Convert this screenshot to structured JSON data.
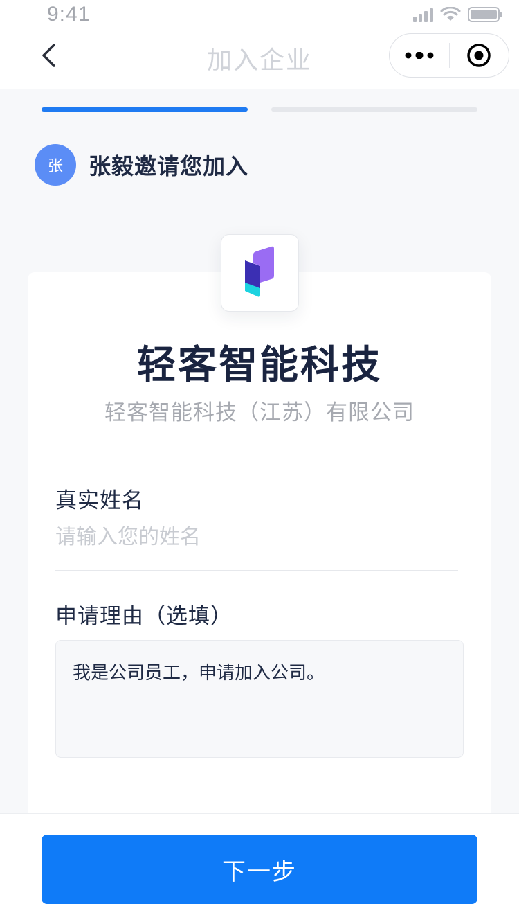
{
  "status_bar": {
    "time": "9:41"
  },
  "nav": {
    "title": "加入企业",
    "back_icon": "chevron-left-icon",
    "more_icon": "more-dots-icon",
    "close_icon": "record-target-icon"
  },
  "progress": {
    "current_step": 1,
    "total_steps": 2
  },
  "inviter": {
    "avatar_text": "张",
    "message": "张毅邀请您加入"
  },
  "company": {
    "short_name": "轻客智能科技",
    "full_name": "轻客智能科技（江苏）有限公司",
    "logo_icon": "company-logo-icon"
  },
  "form": {
    "name_label": "真实姓名",
    "name_placeholder": "请输入您的姓名",
    "name_value": "",
    "reason_label": "申请理由（选填）",
    "reason_value": "我是公司员工，申请加入公司。"
  },
  "footer": {
    "next_label": "下一步"
  },
  "colors": {
    "accent": "#0f7bf8",
    "progress_active": "#1f7bf2",
    "avatar_bg": "#5b8df6"
  }
}
